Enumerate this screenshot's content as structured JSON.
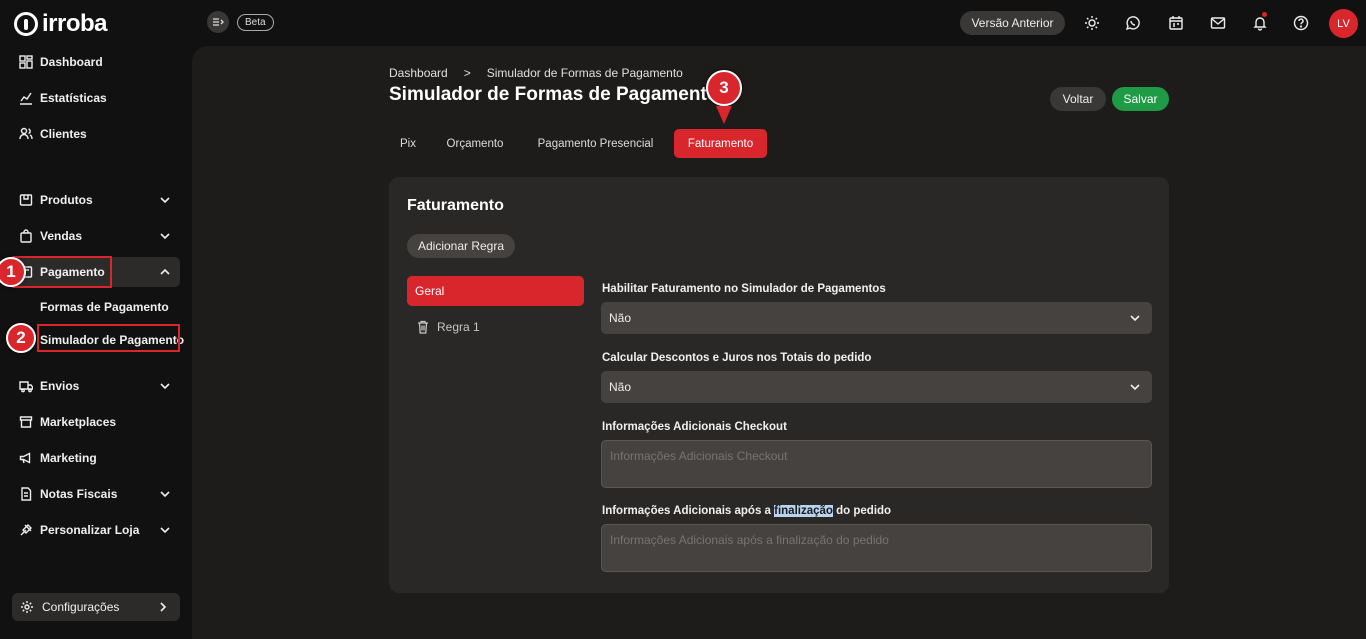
{
  "brand": {
    "name": "irroba"
  },
  "header": {
    "beta_label": "Beta",
    "prev_version_label": "Versão Anterior",
    "avatar_initials": "LV"
  },
  "sidebar": {
    "items": [
      {
        "label": "Dashboard",
        "icon": "dashboard-icon"
      },
      {
        "label": "Estatísticas",
        "icon": "chart-line-icon"
      },
      {
        "label": "Clientes",
        "icon": "users-icon"
      },
      {
        "label": "Produtos",
        "icon": "box-icon"
      },
      {
        "label": "Vendas",
        "icon": "shopping-bag-icon"
      },
      {
        "label": "Pagamento",
        "icon": "payment-icon"
      },
      {
        "label": "Envios",
        "icon": "truck-icon"
      },
      {
        "label": "Marketplaces",
        "icon": "store-icon"
      },
      {
        "label": "Marketing",
        "icon": "megaphone-icon"
      },
      {
        "label": "Notas Fiscais",
        "icon": "invoice-icon"
      },
      {
        "label": "Personalizar Loja",
        "icon": "brush-icon"
      }
    ],
    "sub_items": [
      {
        "label": "Formas de Pagamento"
      },
      {
        "label": "Simulador de Pagamento"
      }
    ],
    "config_label": "Configurações"
  },
  "annotations": {
    "step1": "1",
    "step2": "2",
    "step3": "3"
  },
  "breadcrumb": {
    "home": "Dashboard",
    "separator": ">",
    "current": "Simulador de Formas de Pagamento"
  },
  "page": {
    "title": "Simulador de Formas de Pagamento",
    "back_label": "Voltar",
    "save_label": "Salvar"
  },
  "tabs": [
    {
      "label": "Pix"
    },
    {
      "label": "Orçamento"
    },
    {
      "label": "Pagamento Presencial"
    },
    {
      "label": "Faturamento",
      "active": true
    }
  ],
  "card": {
    "title": "Faturamento",
    "add_rule_label": "Adicionar Regra",
    "rules": [
      {
        "label": "Geral"
      },
      {
        "label": "Regra 1"
      }
    ],
    "fields": {
      "enable_label": "Habilitar Faturamento no Simulador de Pagamentos",
      "enable_value": "Não",
      "discount_label": "Calcular Descontos e Juros nos Totais do pedido",
      "discount_value": "Não",
      "checkout_info_label": "Informações Adicionais Checkout",
      "checkout_info_placeholder": "Informações Adicionais Checkout",
      "after_label_prefix": "Informações Adicionais após a ",
      "after_label_highlight": "finalização",
      "after_label_suffix": " do pedido",
      "after_placeholder": "Informações Adicionais após a finalização do pedido"
    }
  },
  "colors": {
    "accent": "#d9262c",
    "success": "#1f9b45",
    "background": "#111111",
    "panel": "#2a2827"
  }
}
